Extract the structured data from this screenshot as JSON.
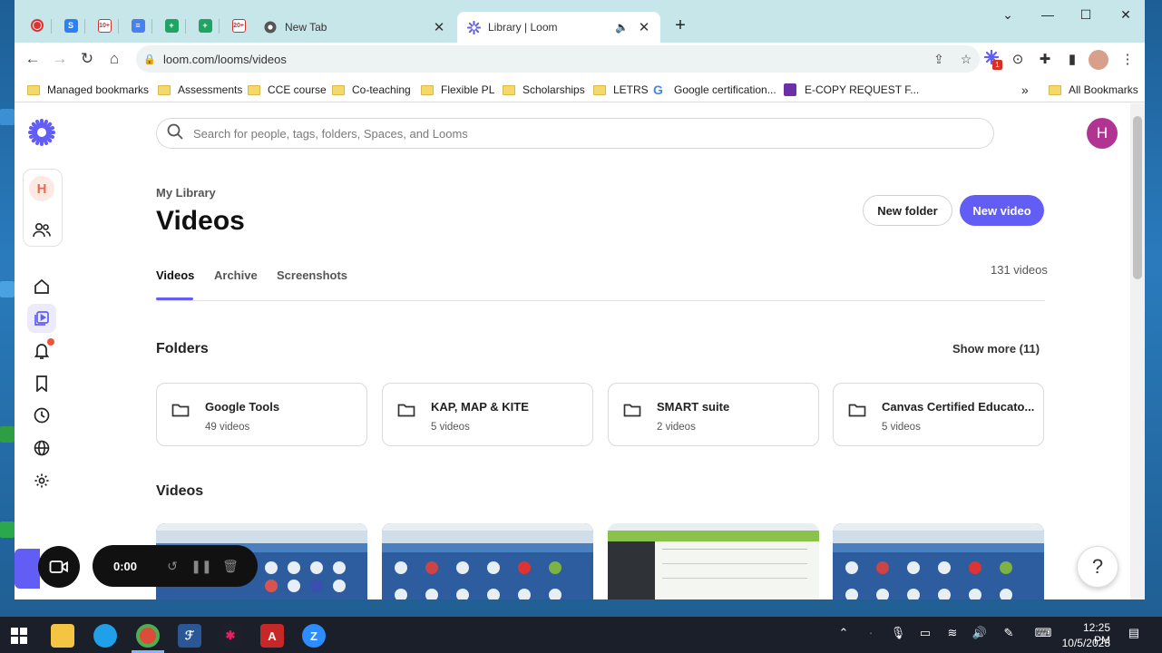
{
  "browser": {
    "tabs": [
      {
        "title": "New Tab",
        "active": false
      },
      {
        "title": "Library | Loom",
        "active": true
      }
    ],
    "url": "loom.com/looms/videos",
    "bookmarks": [
      "Managed bookmarks",
      "Assessments",
      "CCE course",
      "Co-teaching",
      "Flexible PL",
      "Scholarships",
      "LETRS",
      "Google certification...",
      "E-COPY REQUEST F..."
    ],
    "all_bookmarks": "All Bookmarks",
    "pinned_badges": {
      "tab3": "10+",
      "tab6": "20+"
    },
    "extension_badge": "1"
  },
  "loom": {
    "workspace_initial": "H",
    "avatar_initial": "H",
    "search_placeholder": "Search for people, tags, folders, Spaces, and Looms",
    "breadcrumb": "My Library",
    "page_title": "Videos",
    "new_folder_label": "New folder",
    "new_video_label": "New video",
    "tabs": [
      "Videos",
      "Archive",
      "Screenshots"
    ],
    "video_count": "131 videos",
    "folders_title": "Folders",
    "show_more": "Show more (11)",
    "folders": [
      {
        "name": "Google Tools",
        "count": "49 videos"
      },
      {
        "name": "KAP, MAP & KITE",
        "count": "5 videos"
      },
      {
        "name": "SMART suite",
        "count": "2 videos"
      },
      {
        "name": "Canvas Certified Educato...",
        "count": "5 videos"
      }
    ],
    "videos_title": "Videos",
    "help": "?"
  },
  "recorder": {
    "time": "0:00"
  },
  "taskbar": {
    "time": "12:25 PM",
    "date": "10/5/2023"
  },
  "colors": {
    "accent": "#625df5",
    "tabstrip": "#c7e6e9",
    "avatar": "#b13392"
  }
}
